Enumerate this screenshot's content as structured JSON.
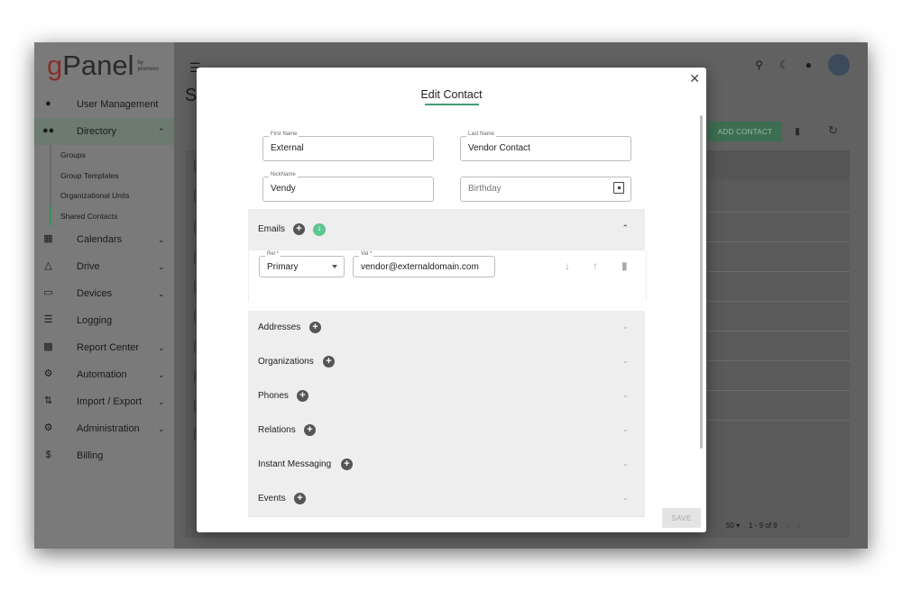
{
  "logo": {
    "g": "g",
    "rest": "Panel",
    "by": "by",
    "brand": "promevo"
  },
  "sidebar": {
    "items": [
      {
        "label": "User Management",
        "icon": "person-icon",
        "chevron": ""
      },
      {
        "label": "Directory",
        "icon": "people-icon",
        "chevron": "^"
      },
      {
        "label": "Calendars",
        "icon": "calendar-icon",
        "chevron": "v"
      },
      {
        "label": "Drive",
        "icon": "drive-icon",
        "chevron": "v"
      },
      {
        "label": "Devices",
        "icon": "devices-icon",
        "chevron": "v"
      },
      {
        "label": "Logging",
        "icon": "list-icon",
        "chevron": ""
      },
      {
        "label": "Report Center",
        "icon": "report-icon",
        "chevron": "v"
      },
      {
        "label": "Automation",
        "icon": "automation-icon",
        "chevron": "v"
      },
      {
        "label": "Import / Export",
        "icon": "import-export-icon",
        "chevron": "v"
      },
      {
        "label": "Administration",
        "icon": "admin-gears-icon",
        "chevron": "v"
      },
      {
        "label": "Billing",
        "icon": "dollar-icon",
        "chevron": ""
      }
    ],
    "directory_sub": [
      "Groups",
      "Group Templates",
      "Organizational Units",
      "Shared Contacts"
    ]
  },
  "main": {
    "page_title": "S",
    "add_contact": "ADD CONTACT",
    "pager": {
      "rows": "50",
      "range": "1 - 9 of 9"
    }
  },
  "dialog": {
    "title": "Edit Contact",
    "first_name": {
      "label": "First Name",
      "value": "External"
    },
    "last_name": {
      "label": "Last Name",
      "value": "Vendor Contact"
    },
    "nickname": {
      "label": "NickName",
      "value": "Vendy"
    },
    "birthday": {
      "placeholder": "Birthday"
    },
    "emails": {
      "title": "Emails",
      "count": "1",
      "rel_label": "Rel *",
      "rel_value": "Primary",
      "val_label": "Val *",
      "val_value": "vendor@externaldomain.com"
    },
    "sections": [
      "Addresses",
      "Organizations",
      "Phones",
      "Relations",
      "Instant Messaging",
      "Events"
    ],
    "save": "SAVE"
  }
}
